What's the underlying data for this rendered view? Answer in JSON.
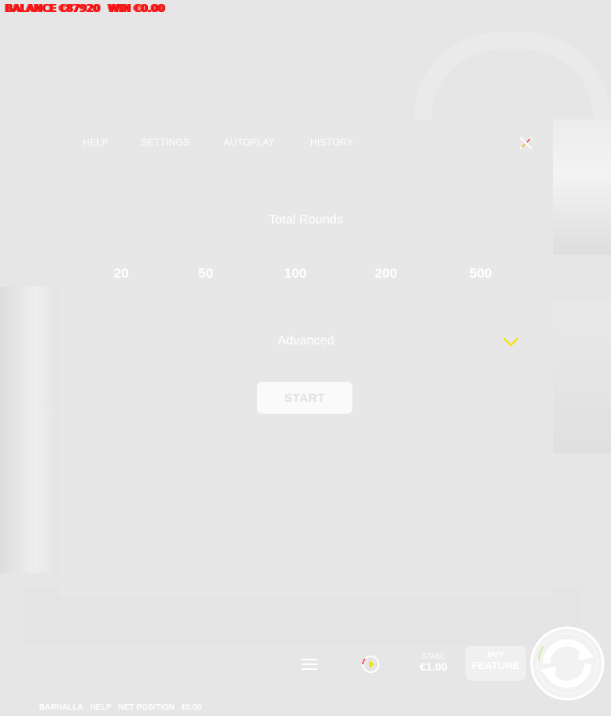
{
  "topbar": {
    "balance": "BALANCE €87920",
    "win": "WIN €0.00"
  },
  "tabs": [
    "HELP",
    "SETTINGS",
    "AUTOPLAY",
    "HISTORY"
  ],
  "autoplay": {
    "title": "Total Rounds",
    "options": [
      "20",
      "50",
      "100",
      "200",
      "500"
    ],
    "advanced_label": "Advanced",
    "start_label": "START"
  },
  "bottom_bar": {
    "stake_label": "STAKE",
    "stake_value": "€1.00",
    "buy_line1": "BUY",
    "buy_line2": "FEATURE"
  },
  "footer": {
    "game_name": "BARHALLA",
    "help_label": "HELP",
    "net_position_label": "NET POSITION",
    "net_position_value": "€0.00"
  },
  "colors": {
    "accent": "#f5e21a",
    "balance_text": "#ff1a1a",
    "spin_green": "#cde9a6"
  },
  "icons": [
    "close-icon",
    "chevron-down-icon",
    "menu-icon",
    "play-icon",
    "spin-icon"
  ]
}
